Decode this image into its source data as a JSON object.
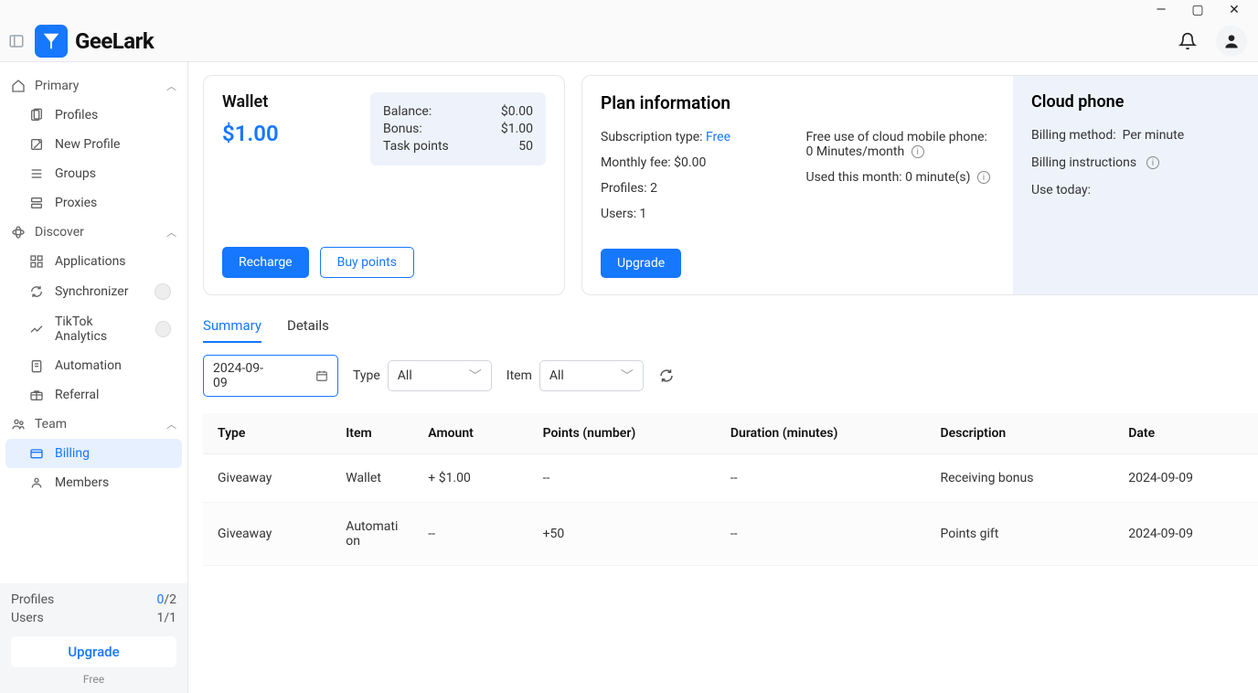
{
  "app": {
    "name": "GeeLark"
  },
  "window": {
    "min": "—",
    "max": "▢",
    "close": "✕"
  },
  "sidebar": {
    "groups": [
      {
        "label": "Primary",
        "items": [
          {
            "label": "Profiles"
          },
          {
            "label": "New Profile"
          },
          {
            "label": "Groups"
          },
          {
            "label": "Proxies"
          }
        ]
      },
      {
        "label": "Discover",
        "items": [
          {
            "label": "Applications"
          },
          {
            "label": "Synchronizer",
            "badge": true
          },
          {
            "label": "TikTok Analytics",
            "badge": true
          },
          {
            "label": "Automation"
          },
          {
            "label": "Referral"
          }
        ]
      },
      {
        "label": "Team",
        "items": [
          {
            "label": "Billing",
            "active": true
          },
          {
            "label": "Members"
          }
        ]
      }
    ],
    "footer": {
      "profiles_label": "Profiles",
      "profiles_used": "0",
      "profiles_total": "/2",
      "users_label": "Users",
      "users_value": "1/1",
      "upgrade": "Upgrade",
      "plan": "Free"
    }
  },
  "wallet": {
    "title": "Wallet",
    "amount": "$1.00",
    "balance_label": "Balance:",
    "balance": "$0.00",
    "bonus_label": "Bonus:",
    "bonus": "$1.00",
    "points_label": "Task points",
    "points": "50",
    "recharge": "Recharge",
    "buy_points": "Buy points"
  },
  "plan": {
    "title": "Plan information",
    "sub_label": "Subscription type: ",
    "sub_value": "Free",
    "fee": "Monthly fee: $0.00",
    "profiles": "Profiles: 2",
    "users": "Users: 1",
    "free_use": "Free use of cloud mobile phone: 0 Minutes/month",
    "used": "Used this month: 0 minute(s)",
    "upgrade": "Upgrade"
  },
  "cloud": {
    "title": "Cloud phone",
    "billing_method_label": "Billing method:",
    "billing_method": "Per minute",
    "billing_instructions": "Billing instructions",
    "use_today": "Use today:"
  },
  "tabs": {
    "summary": "Summary",
    "details": "Details"
  },
  "filters": {
    "date": "2024-09-09",
    "type_label": "Type",
    "type_value": "All",
    "item_label": "Item",
    "item_value": "All"
  },
  "table": {
    "headers": {
      "type": "Type",
      "item": "Item",
      "amount": "Amount",
      "points": "Points (number)",
      "duration": "Duration (minutes)",
      "desc": "Description",
      "date": "Date"
    },
    "rows": [
      {
        "type": "Giveaway",
        "item": "Wallet",
        "amount": "+ $1.00",
        "points": "--",
        "duration": "--",
        "desc": "Receiving bonus",
        "date": "2024-09-09"
      },
      {
        "type": "Giveaway",
        "item": "Automation",
        "amount": "--",
        "points": "+50",
        "duration": "--",
        "desc": "Points gift",
        "date": "2024-09-09"
      }
    ]
  }
}
